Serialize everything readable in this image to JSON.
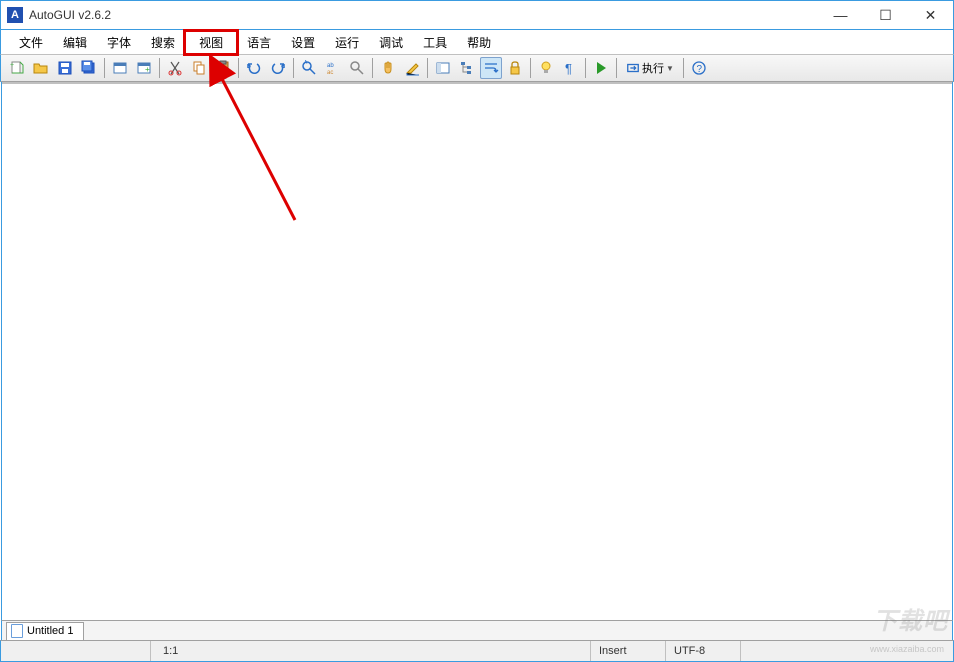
{
  "app": {
    "icon_letter": "A",
    "title": "AutoGUI v2.6.2"
  },
  "window_controls": {
    "minimize": "—",
    "maximize": "☐",
    "close": "✕"
  },
  "menu": {
    "items": [
      "文件",
      "编辑",
      "字体",
      "搜索",
      "视图",
      "语言",
      "设置",
      "运行",
      "调试",
      "工具",
      "帮助"
    ],
    "highlighted_index": 4
  },
  "toolbar": {
    "run_label": "执行"
  },
  "tabs": {
    "items": [
      {
        "label": "Untitled 1"
      }
    ]
  },
  "status": {
    "position": "1:1",
    "mode": "Insert",
    "encoding": "UTF-8"
  },
  "watermark": {
    "text": "下载吧",
    "url": "www.xiazaiba.com"
  }
}
